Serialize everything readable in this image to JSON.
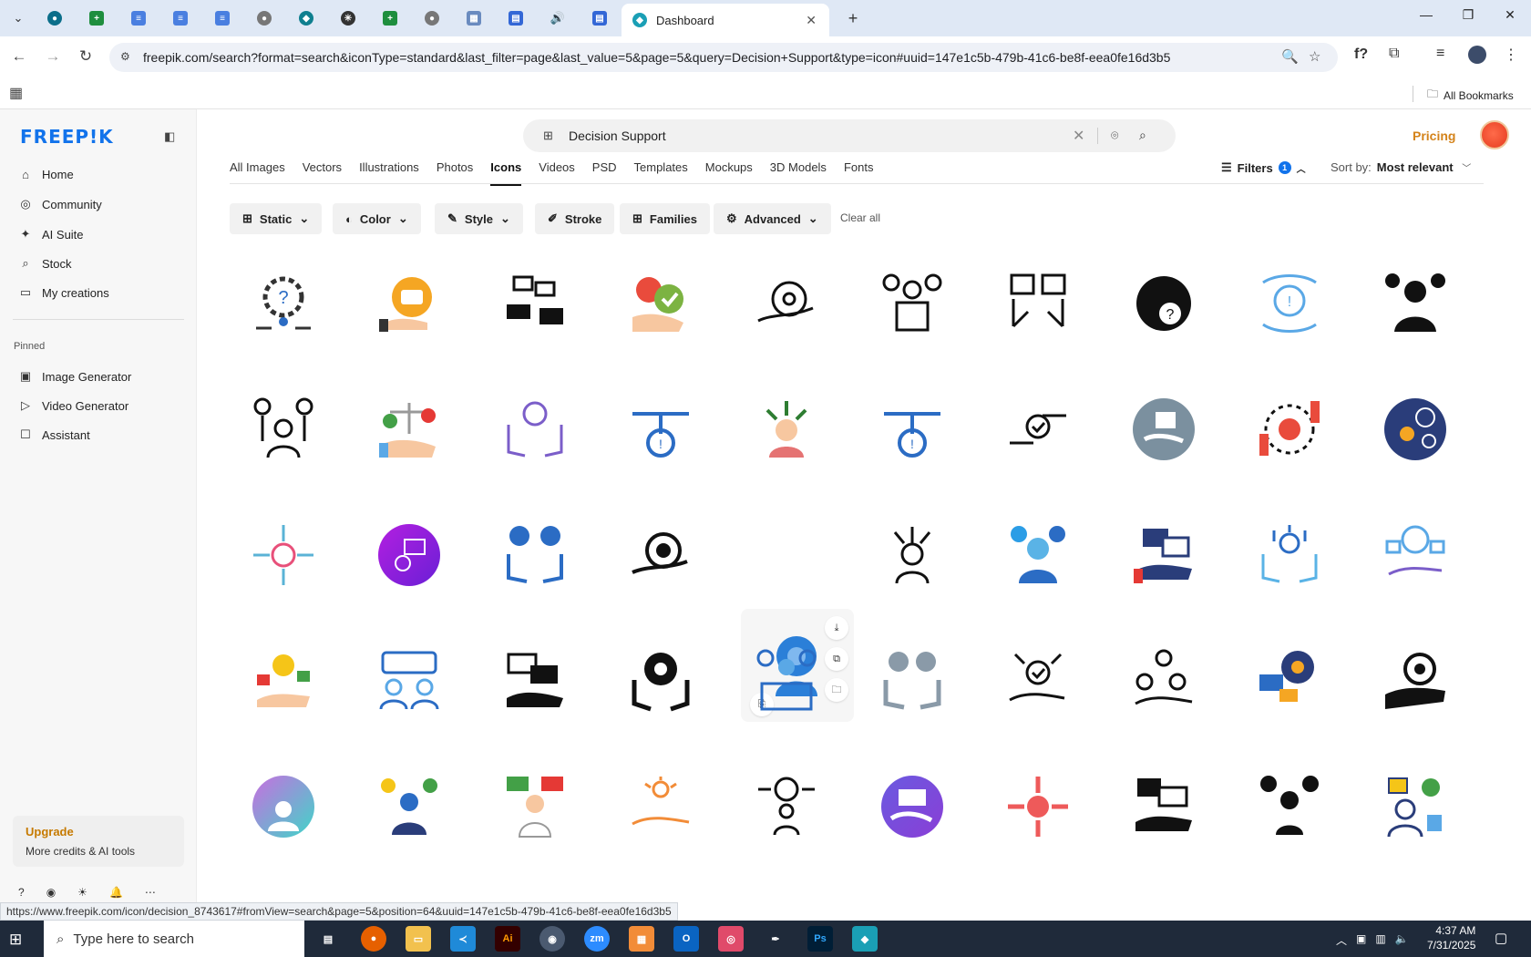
{
  "browser": {
    "active_tab_title": "Dashboard",
    "url": "freepik.com/search?format=search&iconType=standard&last_filter=page&last_value=5&page=5&query=Decision+Support&type=icon#uuid=147e1c5b-479b-41c6-be8f-eea0fe16d3b5",
    "bookmarks_label": "All Bookmarks",
    "status_url": "https://www.freepik.com/icon/decision_8743617#fromView=search&page=5&position=64&uuid=147e1c5b-479b-41c6-be8f-eea0fe16d3b5"
  },
  "sidebar": {
    "logo": "FREEP!K",
    "nav": [
      {
        "label": "Home",
        "icon": "home-icon"
      },
      {
        "label": "Community",
        "icon": "globe-icon"
      },
      {
        "label": "AI Suite",
        "icon": "sparkle-icon"
      },
      {
        "label": "Stock",
        "icon": "search-icon"
      },
      {
        "label": "My creations",
        "icon": "folder-icon"
      }
    ],
    "pinned_heading": "Pinned",
    "pinned": [
      {
        "label": "Image Generator",
        "icon": "image-icon"
      },
      {
        "label": "Video Generator",
        "icon": "video-icon"
      },
      {
        "label": "Assistant",
        "icon": "chat-icon"
      }
    ],
    "upgrade": {
      "title": "Upgrade",
      "subtitle": "More credits & AI tools"
    }
  },
  "search": {
    "query": "Decision Support"
  },
  "header": {
    "pricing": "Pricing"
  },
  "category_tabs": [
    "All Images",
    "Vectors",
    "Illustrations",
    "Photos",
    "Icons",
    "Videos",
    "PSD",
    "Templates",
    "Mockups",
    "3D Models",
    "Fonts"
  ],
  "active_tab": "Icons",
  "filters": {
    "label": "Filters",
    "count": "1",
    "sort_label": "Sort by:",
    "sort_value": "Most relevant",
    "chips": [
      "Static",
      "Color",
      "Style",
      "Stroke",
      "Families",
      "Advanced"
    ],
    "clear": "Clear all"
  },
  "colors": {
    "brand_blue": "#1273eb",
    "pricing_orange": "#d4831a",
    "upgrade_orange": "#c67a00"
  },
  "taskbar": {
    "search_placeholder": "Type here to search",
    "time": "4:37 AM",
    "date": "7/31/2025"
  }
}
